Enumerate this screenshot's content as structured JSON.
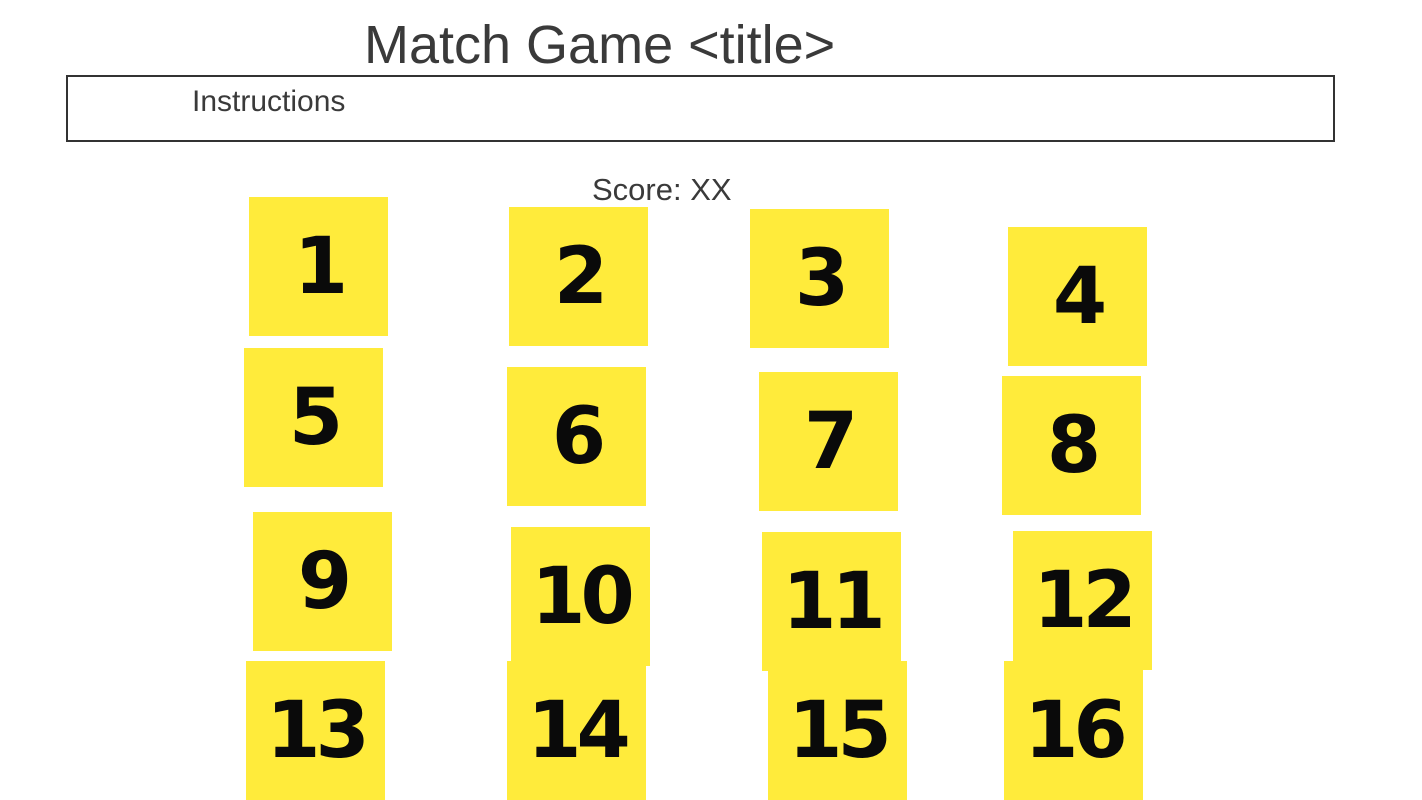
{
  "title": "Match Game <title>",
  "instructions": {
    "label": "Instructions"
  },
  "score": {
    "text": "Score: XX"
  },
  "colors": {
    "card_background": "#ffeb3b",
    "card_text": "#0a0a0a",
    "text": "#3a3a3a"
  },
  "cards": [
    {
      "label": "1"
    },
    {
      "label": "2"
    },
    {
      "label": "3"
    },
    {
      "label": "4"
    },
    {
      "label": "5"
    },
    {
      "label": "6"
    },
    {
      "label": "7"
    },
    {
      "label": "8"
    },
    {
      "label": "9"
    },
    {
      "label": "10"
    },
    {
      "label": "11"
    },
    {
      "label": "12"
    },
    {
      "label": "13"
    },
    {
      "label": "14"
    },
    {
      "label": "15"
    },
    {
      "label": "16"
    }
  ]
}
